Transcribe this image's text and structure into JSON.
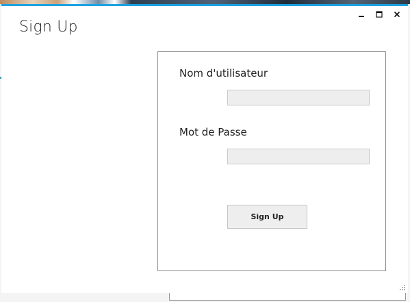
{
  "window": {
    "title": "Sign Up",
    "controls": {
      "minimize_icon": "minimize-icon",
      "maximize_icon": "maximize-icon",
      "close_icon": "close-icon"
    }
  },
  "form": {
    "username_label": "Nom d'utilisateur",
    "username_value": "",
    "password_label": "Mot de Passe",
    "password_value": "",
    "submit_label": "Sign Up"
  },
  "colors": {
    "accent": "#1ba1e2",
    "input_background": "#eeeeee",
    "group_border": "#8a8a8a"
  }
}
